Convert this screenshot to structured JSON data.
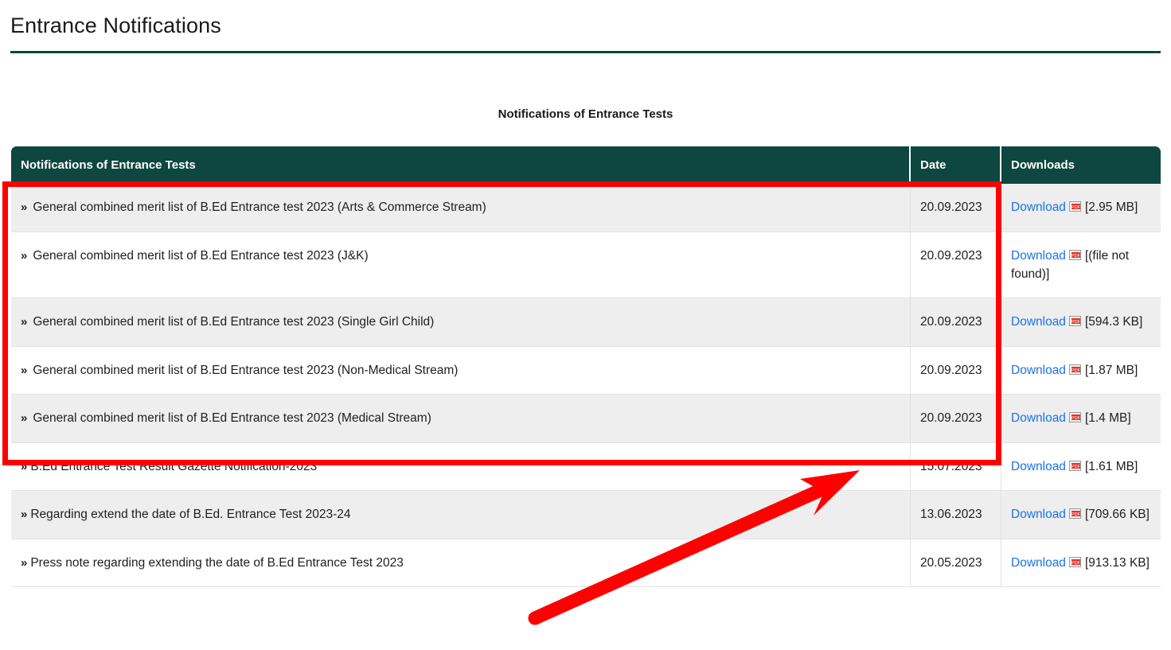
{
  "page": {
    "title": "Entrance Notifications",
    "caption": "Notifications of Entrance Tests"
  },
  "colors": {
    "header_bg": "#0d4740",
    "link": "#1a73e8",
    "annotation": "#ff0000",
    "row_stripe": "#eeeeee"
  },
  "table": {
    "columns": [
      {
        "label": "Notifications of Entrance Tests"
      },
      {
        "label": "Date"
      },
      {
        "label": "Downloads"
      }
    ],
    "download_label": "Download",
    "bullet": "»",
    "rows": [
      {
        "title": "General combined merit list of B.Ed Entrance test 2023 (Arts & Commerce Stream)",
        "date": "20.09.2023",
        "download": "Download",
        "size": "[2.95 MB]"
      },
      {
        "title": "General combined merit list of B.Ed Entrance test 2023 (J&K)",
        "date": "20.09.2023",
        "download": "Download",
        "size": "[(file not found)]"
      },
      {
        "title": "General combined merit list of B.Ed Entrance test 2023 (Single Girl Child)",
        "date": "20.09.2023",
        "download": "Download",
        "size": "[594.3 KB]"
      },
      {
        "title": "General combined merit list of B.Ed Entrance test 2023 (Non-Medical Stream)",
        "date": "20.09.2023",
        "download": "Download",
        "size": "[1.87 MB]"
      },
      {
        "title": "General combined merit list of B.Ed Entrance test 2023 (Medical Stream)",
        "date": "20.09.2023",
        "download": "Download",
        "size": "[1.4 MB]"
      },
      {
        "title": "B.Ed Entrance Test Result Gazette Notification-2023",
        "date": "15.07.2023",
        "download": "Download",
        "size": "[1.61 MB]"
      },
      {
        "title": "Regarding extend the date of B.Ed. Entrance Test 2023-24",
        "date": "13.06.2023",
        "download": "Download",
        "size": "[709.66 KB]"
      },
      {
        "title": "Press note regarding extending the date of B.Ed Entrance Test 2023",
        "date": "20.05.2023",
        "download": "Download",
        "size": "[913.13 KB]"
      }
    ]
  },
  "annotations": {
    "highlight_box": "red-rectangle-around-first-five-rows",
    "arrow": "red-arrow-pointing-to-highlighted-rows"
  }
}
